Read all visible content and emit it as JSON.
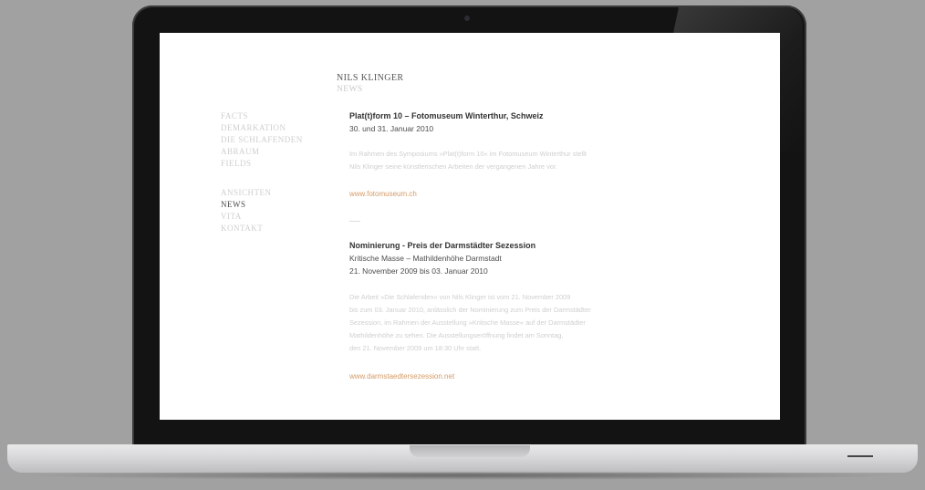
{
  "site": {
    "title": "NILS KLINGER",
    "section": "NEWS"
  },
  "nav": {
    "group1": [
      "FACTS",
      "DEMARKATION",
      "DIE SCHLAFENDEN",
      "ABRAUM",
      "FIELDS"
    ],
    "group2": [
      "ANSICHTEN",
      "NEWS",
      "VITA",
      "KONTAKT"
    ],
    "active": "NEWS"
  },
  "posts": [
    {
      "title": "Plat(t)form 10 – Fotomuseum Winterthur, Schweiz",
      "lines": [
        "30. und 31. Januar 2010"
      ],
      "body": [
        "Im Rahmen des Symposiums »Plat(t)form 10« im Fotomuseum Winterthur stellt",
        "Nils Klinger seine künstlerischen Arbeiten der vergangenen Jahre vor."
      ],
      "link": "www.fotomuseum.ch"
    },
    {
      "title": "Nominierung - Preis der Darmstädter Sezession",
      "lines": [
        "Kritische Masse – Mathildenhöhe Darmstadt",
        "21. November 2009 bis 03. Januar 2010"
      ],
      "body": [
        "Die Arbeit »Die Schlafenden« von Nils Klinger ist vom 21. November 2009",
        "bis zum 03. Januar 2010, anlässlich der Nominierung zum Preis der Darmstädter",
        "Sezession, im Rahmen der Ausstellung »Kritische Masse« auf der Darmstädter",
        "Mathildenhöhe zu sehen. Die Ausstellungseröffnung findet am Sonntag,",
        "den 21. November 2009 um 18:30 Uhr statt."
      ],
      "link": "www.darmstaedtersezession.net"
    }
  ]
}
